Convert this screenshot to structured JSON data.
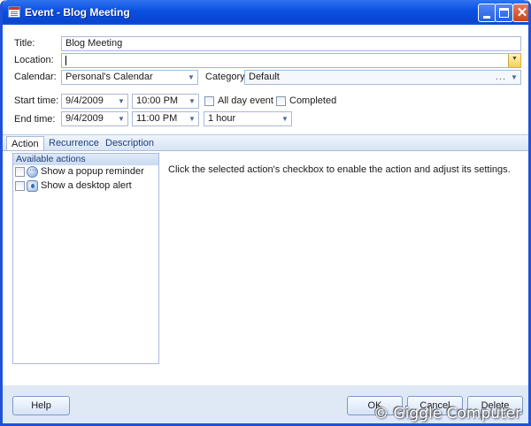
{
  "window": {
    "title": "Event - Blog Meeting",
    "close_glyph": "✕"
  },
  "form": {
    "title_label": "Title:",
    "title_value": "Blog Meeting",
    "location_label": "Location:",
    "location_value": "",
    "calendar_label": "Calendar:",
    "calendar_value": "Personal's Calendar",
    "category_label": "Category:",
    "category_value": "Default",
    "category_dots": "...",
    "start_label": "Start time:",
    "start_date": "9/4/2009",
    "start_time": "10:00 PM",
    "all_day_label": "All day event",
    "completed_label": "Completed",
    "end_label": "End time:",
    "end_date": "9/4/2009",
    "end_time": "11:00 PM",
    "duration": "1 hour"
  },
  "tabs": [
    {
      "label": "Action",
      "active": true
    },
    {
      "label": "Recurrence",
      "active": false
    },
    {
      "label": "Description",
      "active": false
    }
  ],
  "actions": {
    "header": "Available actions",
    "items": [
      {
        "label": "Show a popup reminder",
        "icon": "popup-reminder-icon",
        "checked": false
      },
      {
        "label": "Show a desktop alert",
        "icon": "desktop-alert-icon",
        "checked": false
      }
    ],
    "hint": "Click the selected action's checkbox to enable the action and adjust its settings."
  },
  "buttons": {
    "help": "Help",
    "ok": "OK",
    "cancel": "Cancel",
    "delete": "Delete"
  },
  "watermark": "© Giggle Computer"
}
